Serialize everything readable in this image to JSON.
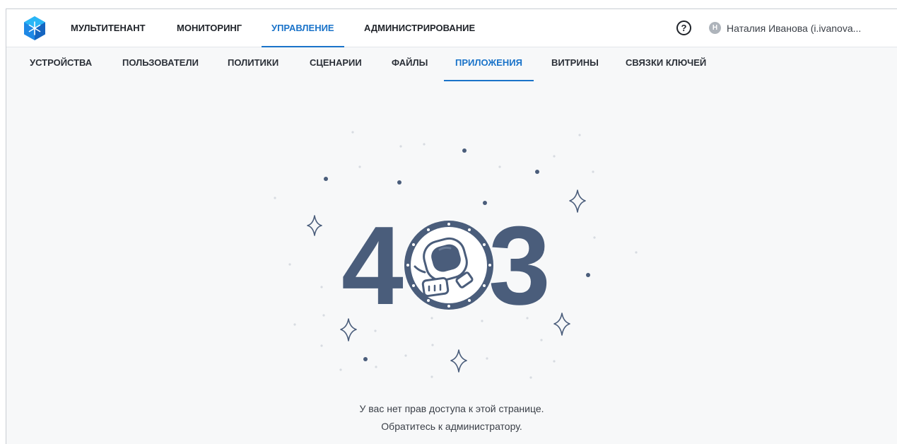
{
  "app": {
    "logo_icon": "snowflake-cube-icon"
  },
  "topnav": {
    "items": [
      {
        "label": "МУЛЬТИТЕНАНТ"
      },
      {
        "label": "МОНИТОРИНГ"
      },
      {
        "label": "УПРАВЛЕНИЕ",
        "active": true
      },
      {
        "label": "АДМИНИСТРИРОВАНИЕ"
      }
    ],
    "help_symbol": "?",
    "avatar_initial": "Н",
    "user_name": "Наталия Иванова (i.ivanova..."
  },
  "subnav": {
    "items": [
      {
        "label": "УСТРОЙСТВА"
      },
      {
        "label": "ПОЛЬЗОВАТЕЛИ"
      },
      {
        "label": "ПОЛИТИКИ"
      },
      {
        "label": "СЦЕНАРИИ"
      },
      {
        "label": "ФАЙЛЫ"
      },
      {
        "label": "ПРИЛОЖЕНИЯ",
        "active": true
      },
      {
        "label": "ВИТРИНЫ"
      },
      {
        "label": "СВЯЗКИ КЛЮЧЕЙ"
      }
    ]
  },
  "error": {
    "code_left": "4",
    "code_right": "3",
    "illustration_icon": "astronaut-porthole-icon",
    "message_line1": "У вас нет прав доступа к этой странице.",
    "message_line2": "Обратитесь к администратору."
  },
  "colors": {
    "accent": "#1a73c9",
    "illustration": "#4a5d7b"
  }
}
